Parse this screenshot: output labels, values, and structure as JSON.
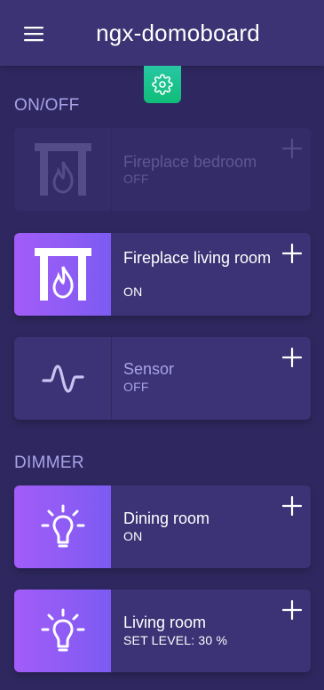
{
  "header": {
    "title": "ngx-domoboard",
    "menu_icon": "hamburger-menu-icon",
    "settings_icon": "gear-icon",
    "settings_color": "#1ec08a"
  },
  "sections": [
    {
      "title": "ON/OFF",
      "cards": [
        {
          "name": "Fireplace bedroom",
          "state": "OFF",
          "icon": "fireplace-icon",
          "status": "off",
          "enabled": false
        },
        {
          "name": "Fireplace living room",
          "state": "ON",
          "icon": "fireplace-icon",
          "status": "on",
          "enabled": true
        },
        {
          "name": "Sensor",
          "state": "OFF",
          "icon": "pulse-icon",
          "status": "off",
          "enabled": true
        }
      ]
    },
    {
      "title": "DIMMER",
      "cards": [
        {
          "name": "Dining room",
          "state": "ON",
          "icon": "light-bulb-icon",
          "status": "on",
          "enabled": true
        },
        {
          "name": "Living room",
          "state": "SET LEVEL: 30 %",
          "icon": "light-bulb-icon",
          "status": "on",
          "enabled": true,
          "level_percent": 30
        }
      ]
    }
  ],
  "colors": {
    "background": "#2f2860",
    "header": "#3b3373",
    "card": "#3b3375",
    "accent_gradient_start": "#a35cf8",
    "accent_gradient_end": "#7c5bf2",
    "section_title": "#a9a2e8"
  }
}
